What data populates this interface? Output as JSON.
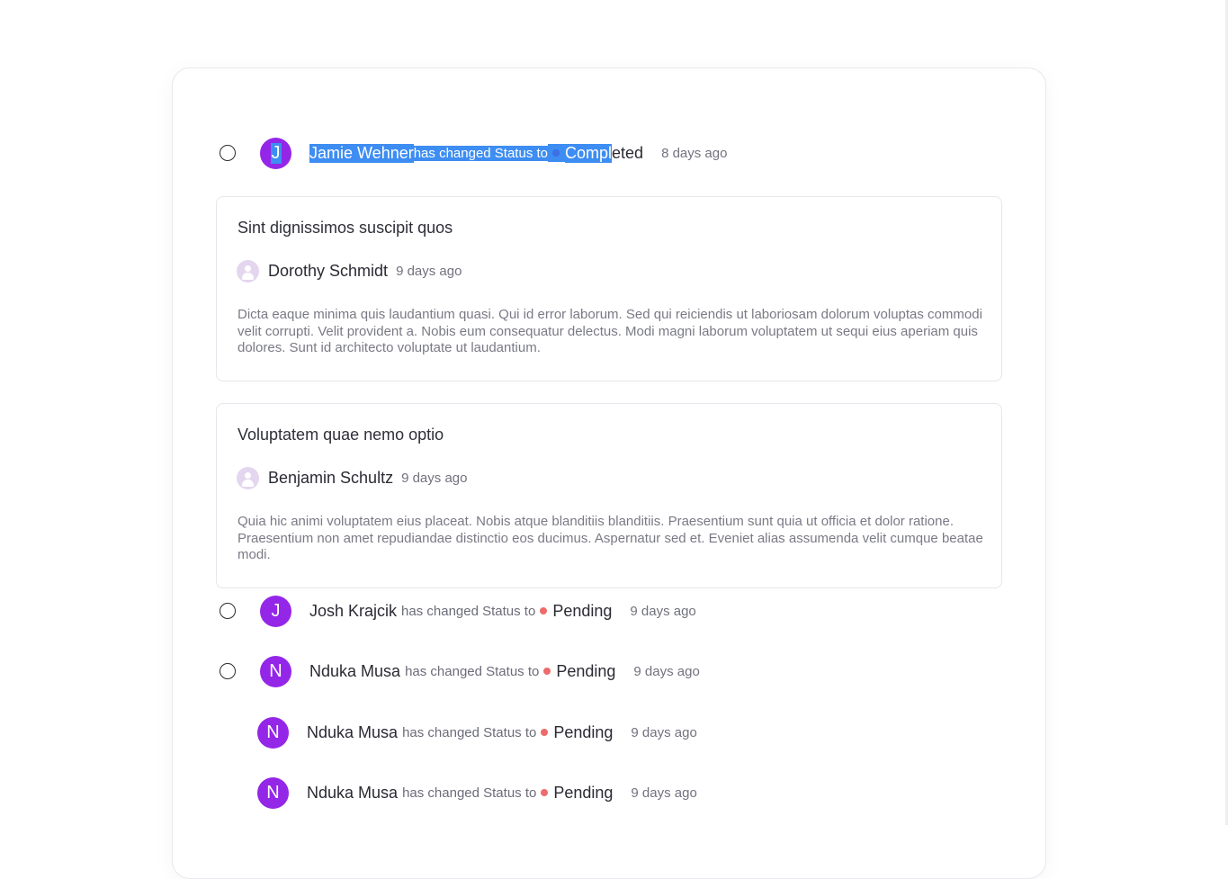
{
  "activities": [
    {
      "initial": "J",
      "name": "Jamie Wehner",
      "verb": "has changed Status to",
      "status_a": "Compl",
      "status_b": "eted",
      "status_color": "#3d6fe6",
      "time": "8 days ago"
    },
    {
      "initial": "J",
      "name": "Josh Krajcik",
      "verb": "has changed Status to",
      "status": "Pending",
      "status_color": "#ee6b6b",
      "time": "9 days ago"
    },
    {
      "initial": "N",
      "name": "Nduka Musa",
      "verb": "has changed Status to",
      "status": "Pending",
      "status_color": "#ee6b6b",
      "time": "9 days ago"
    },
    {
      "initial": "N",
      "name": "Nduka Musa",
      "verb": "has changed Status to",
      "status": "Pending",
      "status_color": "#ee6b6b",
      "time": "9 days ago"
    },
    {
      "initial": "N",
      "name": "Nduka Musa",
      "verb": "has changed Status to",
      "status": "Pending",
      "status_color": "#ee6b6b",
      "time": "9 days ago"
    }
  ],
  "comments": [
    {
      "title": "Sint dignissimos suscipit quos",
      "author": "Dorothy Schmidt",
      "time": "9 days ago",
      "body": "Dicta eaque minima quis laudantium quasi. Qui id error laborum. Sed qui reiciendis ut laboriosam dolorum voluptas commodi velit corrupti. Velit provident a. Nobis eum consequatur delectus. Modi magni laborum voluptatem ut sequi eius aperiam quis dolores. Sunt id architecto voluptate ut laudantium."
    },
    {
      "title": "Voluptatem quae nemo optio",
      "author": "Benjamin Schultz",
      "time": "9 days ago",
      "body": "Quia hic animi voluptatem eius placeat. Nobis atque blanditiis blanditiis. Praesentium sunt quia ut officia et dolor ratione. Praesentium non amet repudiandae distinctio eos ducimus. Aspernatur sed et. Eveniet alias assumenda velit cumque beatae modi."
    }
  ],
  "colors": {
    "avatar": "#9426e8",
    "selection": "#3d8df2"
  }
}
